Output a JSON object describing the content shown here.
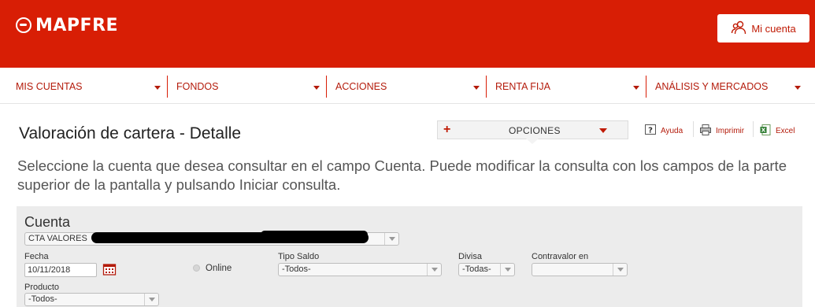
{
  "brand": {
    "name": "MAPFRE",
    "color": "#d81e05"
  },
  "header": {
    "account_button": "Mi cuenta",
    "account_icon": "users-icon"
  },
  "nav": {
    "items": [
      {
        "label": "MIS CUENTAS"
      },
      {
        "label": "FONDOS"
      },
      {
        "label": "ACCIONES"
      },
      {
        "label": "RENTA FIJA"
      },
      {
        "label": "ANÁLISIS Y MERCADOS"
      }
    ]
  },
  "page": {
    "title": "Valoración de cartera - Detalle",
    "options_label": "OPCIONES",
    "tools": {
      "help": "Ayuda",
      "print": "Imprimir",
      "excel": "Excel"
    },
    "intro": "Seleccione la cuenta que desea consultar en el campo Cuenta. Puede modificar la consulta con los campos de la parte superior de la pantalla y pulsando Iniciar consulta."
  },
  "form": {
    "cuenta_label": "Cuenta",
    "cuenta_value": "CTA VALORES",
    "fecha_label": "Fecha",
    "fecha_value": "10/11/2018",
    "online_label": "Online",
    "tipo_saldo_label": "Tipo Saldo",
    "tipo_saldo_value": "-Todos-",
    "divisa_label": "Divisa",
    "divisa_value": "-Todas-",
    "contravalor_label": "Contravalor en",
    "contravalor_value": "",
    "producto_label": "Producto",
    "producto_value": "-Todos-"
  }
}
